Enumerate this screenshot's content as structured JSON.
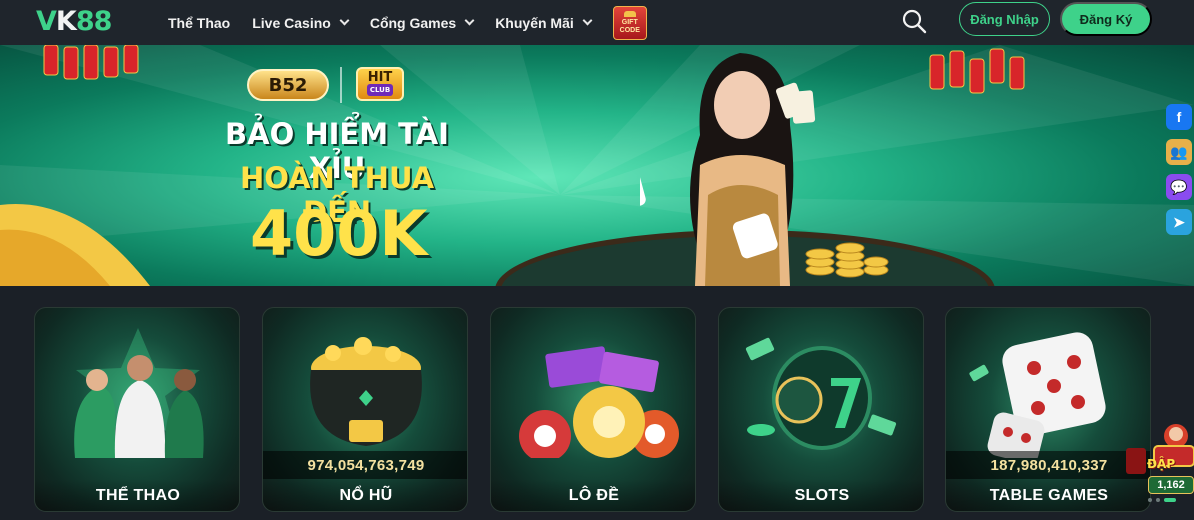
{
  "header": {
    "logo": {
      "v": "V",
      "k": "K",
      "n": "88"
    },
    "nav": [
      {
        "label": "Thể Thao",
        "has_dropdown": false
      },
      {
        "label": "Live Casino",
        "has_dropdown": true
      },
      {
        "label": "Cổng Games",
        "has_dropdown": true
      },
      {
        "label": "Khuyến Mãi",
        "has_dropdown": true
      }
    ],
    "gift_code": {
      "line1": "GIFT",
      "line2": "CODE"
    },
    "search_icon": "search-icon",
    "login_label": "Đăng Nhập",
    "register_label": "Đăng Ký",
    "accent": "#3ed28a"
  },
  "banner": {
    "brand1": "B52",
    "brand2": "HIT",
    "brand2_sub": "CLUB",
    "line1": "BẢO HIỂM TÀI XỈU",
    "line2": "HOÀN THUA ĐẾN",
    "line3": "400K"
  },
  "social": [
    {
      "icon": "facebook-icon",
      "glyph": "f"
    },
    {
      "icon": "group-icon",
      "glyph": "👥"
    },
    {
      "icon": "messenger-icon",
      "glyph": "💬"
    },
    {
      "icon": "telegram-icon",
      "glyph": "➤"
    }
  ],
  "games": [
    {
      "label": "THỂ THAO",
      "jackpot": ""
    },
    {
      "label": "NỔ HŨ",
      "jackpot": "974,054,763,749"
    },
    {
      "label": "LÔ ĐỀ",
      "jackpot": ""
    },
    {
      "label": "SLOTS",
      "jackpot": ""
    },
    {
      "label": "TABLE GAMES",
      "jackpot": "187,980,410,337"
    }
  ],
  "promo": {
    "title": "ĐẬP",
    "count": "1,162"
  }
}
